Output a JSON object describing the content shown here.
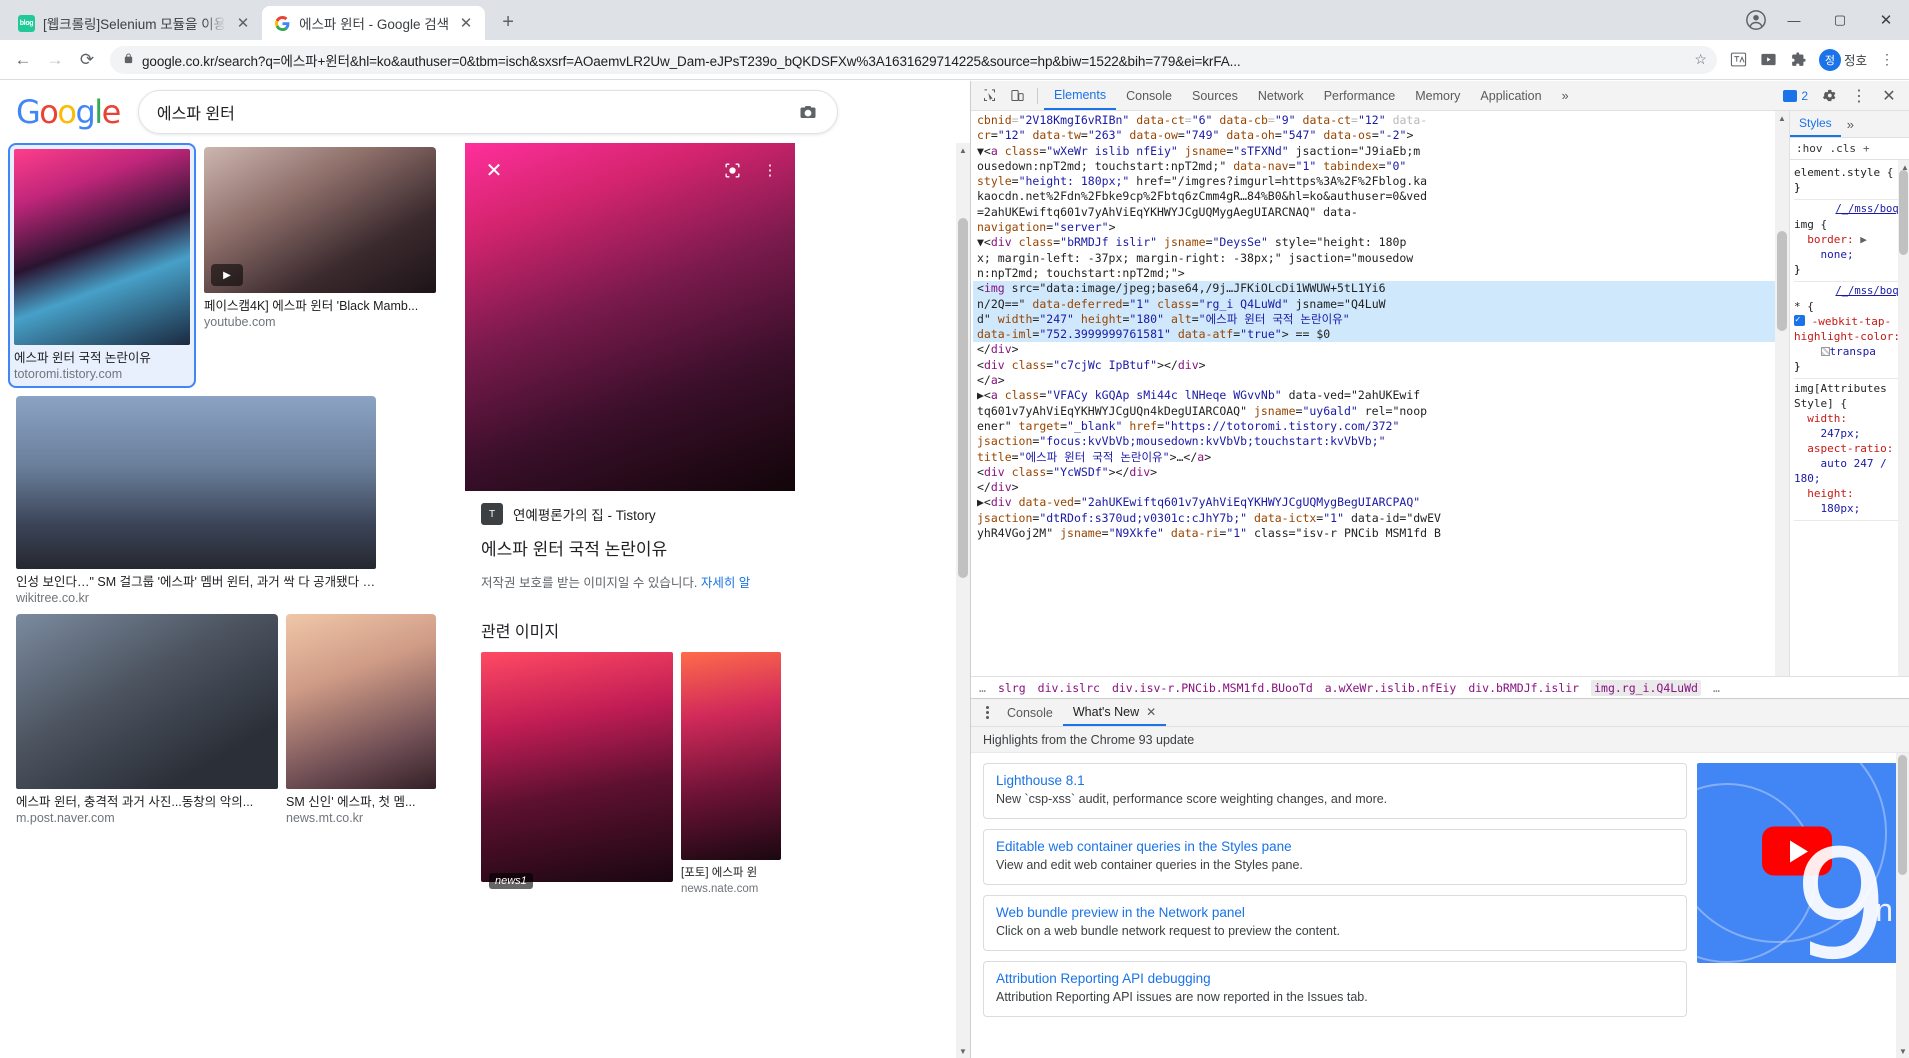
{
  "browser": {
    "tabs": [
      {
        "title": "[웹크롤링]Selenium 모듈을 이용",
        "favicon": "blog-icon",
        "active": false
      },
      {
        "title": "에스파 윈터 - Google 검색",
        "favicon": "google-icon",
        "active": true
      }
    ],
    "newtab_label": "+",
    "window_controls": {
      "minimize": "—",
      "maximize": "▢",
      "close": "✕"
    },
    "toolbar": {
      "back": "←",
      "forward": "→",
      "reload": "⟳",
      "lock_icon": "🔒",
      "url": "google.co.kr/search?q=에스파+윈터&hl=ko&authuser=0&tbm=isch&sxsrf=AOaemvLR2Uw_Dam-eJPsT239o_bQKDSFXw%3A1631629714225&source=hp&biw=1522&bih=779&ei=krFA...",
      "star": "☆",
      "profile_name": "정호",
      "profile_initial": "정"
    }
  },
  "google": {
    "logo": "Google",
    "query": "에스파 윈터",
    "camera_icon": "camera-icon",
    "results": [
      {
        "title": "에스파 윈터 국적 논란이유",
        "source": "totoromi.tistory.com",
        "selected": true
      },
      {
        "title": "페이스캠4K] 에스파 윈터 'Black Mamb...",
        "source": "youtube.com",
        "video": true
      },
      {
        "title": "인성 보인다…\" SM 걸그룹 '에스파' 멤버 윈터, 과거 싹 다 공개됐다 | 위키트리",
        "source": "wikitree.co.kr"
      },
      {
        "title": "에스파 윈터, 충격적 과거 사진...동창의 악의...",
        "source": "m.post.naver.com"
      },
      {
        "title": "SM 신인' 에스파, 첫 멤...",
        "source": "news.mt.co.kr"
      }
    ],
    "detail": {
      "source_name": "연예평론가의 집 - Tistory",
      "title": "에스파 윈터 국적 논란이유",
      "copyright_note": "저작권 보호를 받는 이미지일 수 있습니다. ",
      "copyright_link": "자세히 알",
      "related_heading": "관련 이미지",
      "related": [
        {
          "badge": "news1"
        },
        {
          "caption": "[포토] 에스파 윈",
          "source": "news.nate.com"
        }
      ],
      "close_icon": "close-icon",
      "lens_icon": "google-lens-icon",
      "more_icon": "more-vertical-icon"
    }
  },
  "devtools": {
    "inspect_icon": "inspect-cursor-icon",
    "device_icon": "device-toolbar-icon",
    "tabs": [
      "Elements",
      "Console",
      "Sources",
      "Network",
      "Performance",
      "Memory",
      "Application"
    ],
    "active_tab": "Elements",
    "overflow": "»",
    "issues_count": "2",
    "settings_icon": "gear-icon",
    "more_icon": "more-vertical-icon",
    "close_icon": "close-icon",
    "dom_lines": [
      {
        "text": "cbnid=\"2V18KmgI6vRIBn\" data-ct=\"6\" data-cb=\"9\" data-ct=\"12\" data-",
        "sel": false,
        "faded": true
      },
      {
        "text": "cr=\"12\" data-tw=\"263\" data-ow=\"749\" data-oh=\"547\" data-os=\"-2\">",
        "sel": false
      },
      {
        "text": "▼<a class=\"wXeWr islib nfEiy\" jsname=\"sTFXNd\" jsaction=\"J9iaEb;m",
        "sel": false
      },
      {
        "text": "ousedown:npT2md; touchstart:npT2md;\" data-nav=\"1\" tabindex=\"0\"",
        "sel": false
      },
      {
        "text": "style=\"height: 180px;\" href=\"/imgres?imgurl=https%3A%2F%2Fblog.ka",
        "sel": false
      },
      {
        "text": "kaocdn.net%2Fdn%2Fbke9cp%2Fbtq6zCmm4gR…84%B0&hl=ko&authuser=0&ved",
        "sel": false
      },
      {
        "text": "=2ahUKEwiftq601v7yAhViEqYKHWYJCgUQMygAegUIARCNAQ\" data-",
        "sel": false
      },
      {
        "text": "navigation=\"server\">",
        "sel": false
      },
      {
        "text": "▼<div class=\"bRMDJf islir\" jsname=\"DeysSe\" style=\"height: 180p",
        "sel": false
      },
      {
        "text": "x; margin-left: -37px; margin-right: -38px;\" jsaction=\"mousedow",
        "sel": false
      },
      {
        "text": "n:npT2md; touchstart:npT2md;\">",
        "sel": false
      },
      {
        "text": "<img src=\"data:image/jpeg;base64,/9j…JFKiOLcDi1WWUW+5tL1Yi6",
        "sel": true
      },
      {
        "text": "n/2Q==\" data-deferred=\"1\" class=\"rg_i Q4LuWd\" jsname=\"Q4LuW",
        "sel": true
      },
      {
        "text": "d\" width=\"247\" height=\"180\" alt=\"에스파 윈터 국적 논란이유\"",
        "sel": true
      },
      {
        "text": "data-iml=\"752.3999999761581\" data-atf=\"true\"> == $0",
        "sel": true
      },
      {
        "text": "</div>",
        "sel": false
      },
      {
        "text": "<div class=\"c7cjWc IpBtuf\"></div>",
        "sel": false
      },
      {
        "text": "</a>",
        "sel": false
      },
      {
        "text": "▶<a class=\"VFACy kGQAp sMi44c lNHeqe WGvvNb\" data-ved=\"2ahUKEwif",
        "sel": false
      },
      {
        "text": "tq601v7yAhViEqYKHWYJCgUQn4kDegUIARCOAQ\" jsname=\"uy6ald\" rel=\"noop",
        "sel": false
      },
      {
        "text": "ener\" target=\"_blank\" href=\"https://totoromi.tistory.com/372\"",
        "sel": false
      },
      {
        "text": "jsaction=\"focus:kvVbVb;mousedown:kvVbVb;touchstart:kvVbVb;\"",
        "sel": false
      },
      {
        "text": "title=\"에스파 윈터 국적 논란이유\">…</a>",
        "sel": false
      },
      {
        "text": "<div class=\"YcWSDf\"></div>",
        "sel": false
      },
      {
        "text": "</div>",
        "sel": false
      },
      {
        "text": "▶<div data-ved=\"2ahUKEwiftq601v7yAhViEqYKHWYJCgUQMygBegUIARCPAQ\"",
        "sel": false
      },
      {
        "text": "jsaction=\"dtRDof:s370ud;v0301c:cJhY7b;\" data-ictx=\"1\" data-id=\"dwEV",
        "sel": false
      },
      {
        "text": "yhR4VGoj2M\" jsname=\"N9Xkfe\" data-ri=\"1\" class=\"isv-r PNCib MSM1fd B",
        "sel": false
      }
    ],
    "breadcrumb": [
      "…",
      "slrg",
      "div.islrc",
      "div.isv-r.PNCib.MSM1fd.BUooTd",
      "a.wXeWr.islib.nfEiy",
      "div.bRMDJf.islir",
      "img.rg_i.Q4LuWd",
      "…"
    ],
    "styles": {
      "tab": "Styles",
      "more": "»",
      "toolbar": [
        ":hov",
        ".cls",
        "+"
      ],
      "rules": [
        {
          "source": "",
          "selector": "element.style {",
          "decls": [],
          "close": "}"
        },
        {
          "source": "/_/mss/boq…",
          "selector": "img {",
          "decls": [
            {
              "prop": "border:",
              "value": "none;",
              "expand": true
            }
          ],
          "close": "}"
        },
        {
          "source": "/_/mss/boq…",
          "selector": "* {",
          "decls": [
            {
              "prop": "-webkit-tap-highlight-color:",
              "value": "transpa",
              "checkbox": true,
              "swatch": true
            }
          ],
          "close": "}"
        },
        {
          "source": "",
          "selector": "img[Attributes Style] {",
          "decls": [
            {
              "prop": "width:",
              "value": "247px;"
            },
            {
              "prop": "aspect-ratio:",
              "value": "auto 247 / 180;"
            },
            {
              "prop": "height:",
              "value": "180px;"
            }
          ],
          "close": ""
        }
      ]
    },
    "drawer": {
      "tabs": [
        "Console",
        "What's New"
      ],
      "active_tab": "What's New",
      "close_icon": "✕",
      "subtitle": "Highlights from the Chrome 93 update",
      "items": [
        {
          "title": "Lighthouse 8.1",
          "desc": "New `csp-xss` audit, performance score weighting changes, and more."
        },
        {
          "title": "Editable web container queries in the Styles pane",
          "desc": "View and edit web container queries in the Styles pane."
        },
        {
          "title": "Web bundle preview in the Network panel",
          "desc": "Click on a web bundle network request to preview the content."
        },
        {
          "title": "Attribution Reporting API debugging",
          "desc": "Attribution Reporting API issues are now reported in the Issues tab."
        }
      ],
      "promo": {
        "version": "9",
        "suffix": "n",
        "icon": "youtube-icon"
      }
    }
  }
}
